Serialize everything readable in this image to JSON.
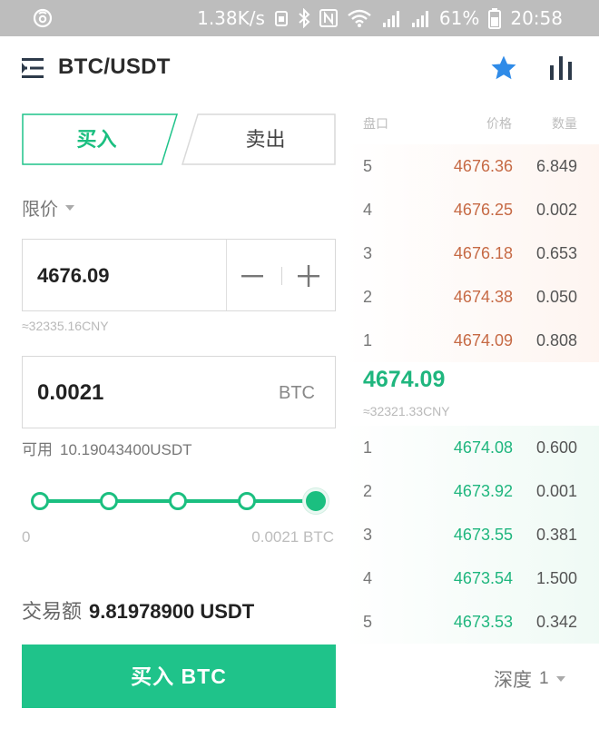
{
  "status_bar": {
    "speed": "1.38K/s",
    "battery": "61%",
    "time": "20:58"
  },
  "header": {
    "pair": "BTC/USDT",
    "icons": [
      "menu-icon",
      "star-icon",
      "bar-chart-icon"
    ]
  },
  "tabs": {
    "buy": "买入",
    "sell": "卖出"
  },
  "order_type": "限价",
  "price_input": {
    "value": "4676.09",
    "cny": "≈32335.16CNY"
  },
  "amount_input": {
    "value": "0.0021",
    "unit": "BTC"
  },
  "available": {
    "label": "可用",
    "value": "10.19043400USDT"
  },
  "slider": {
    "min_label": "0",
    "max_label": "0.0021 BTC",
    "level": 1.0
  },
  "total": {
    "label": "交易额",
    "value": "9.81978900 USDT"
  },
  "buy_button": "买入 BTC",
  "order_book": {
    "headers": {
      "level": "盘口",
      "price": "价格",
      "qty": "数量"
    },
    "asks": [
      {
        "level": "5",
        "price": "4676.36",
        "qty": "6.849"
      },
      {
        "level": "4",
        "price": "4676.25",
        "qty": "0.002"
      },
      {
        "level": "3",
        "price": "4676.18",
        "qty": "0.653"
      },
      {
        "level": "2",
        "price": "4674.38",
        "qty": "0.050"
      },
      {
        "level": "1",
        "price": "4674.09",
        "qty": "0.808"
      }
    ],
    "last_price": "4674.09",
    "last_price_cny": "≈32321.33CNY",
    "bids": [
      {
        "level": "1",
        "price": "4674.08",
        "qty": "0.600"
      },
      {
        "level": "2",
        "price": "4673.92",
        "qty": "0.001"
      },
      {
        "level": "3",
        "price": "4673.55",
        "qty": "0.381"
      },
      {
        "level": "4",
        "price": "4673.54",
        "qty": "1.500"
      },
      {
        "level": "5",
        "price": "4673.53",
        "qty": "0.342"
      }
    ],
    "depth_label": "深度",
    "depth_value": "1"
  },
  "colors": {
    "accent_green": "#1fc38a",
    "ask_red": "#c66a45",
    "star_blue": "#2f8be8"
  }
}
